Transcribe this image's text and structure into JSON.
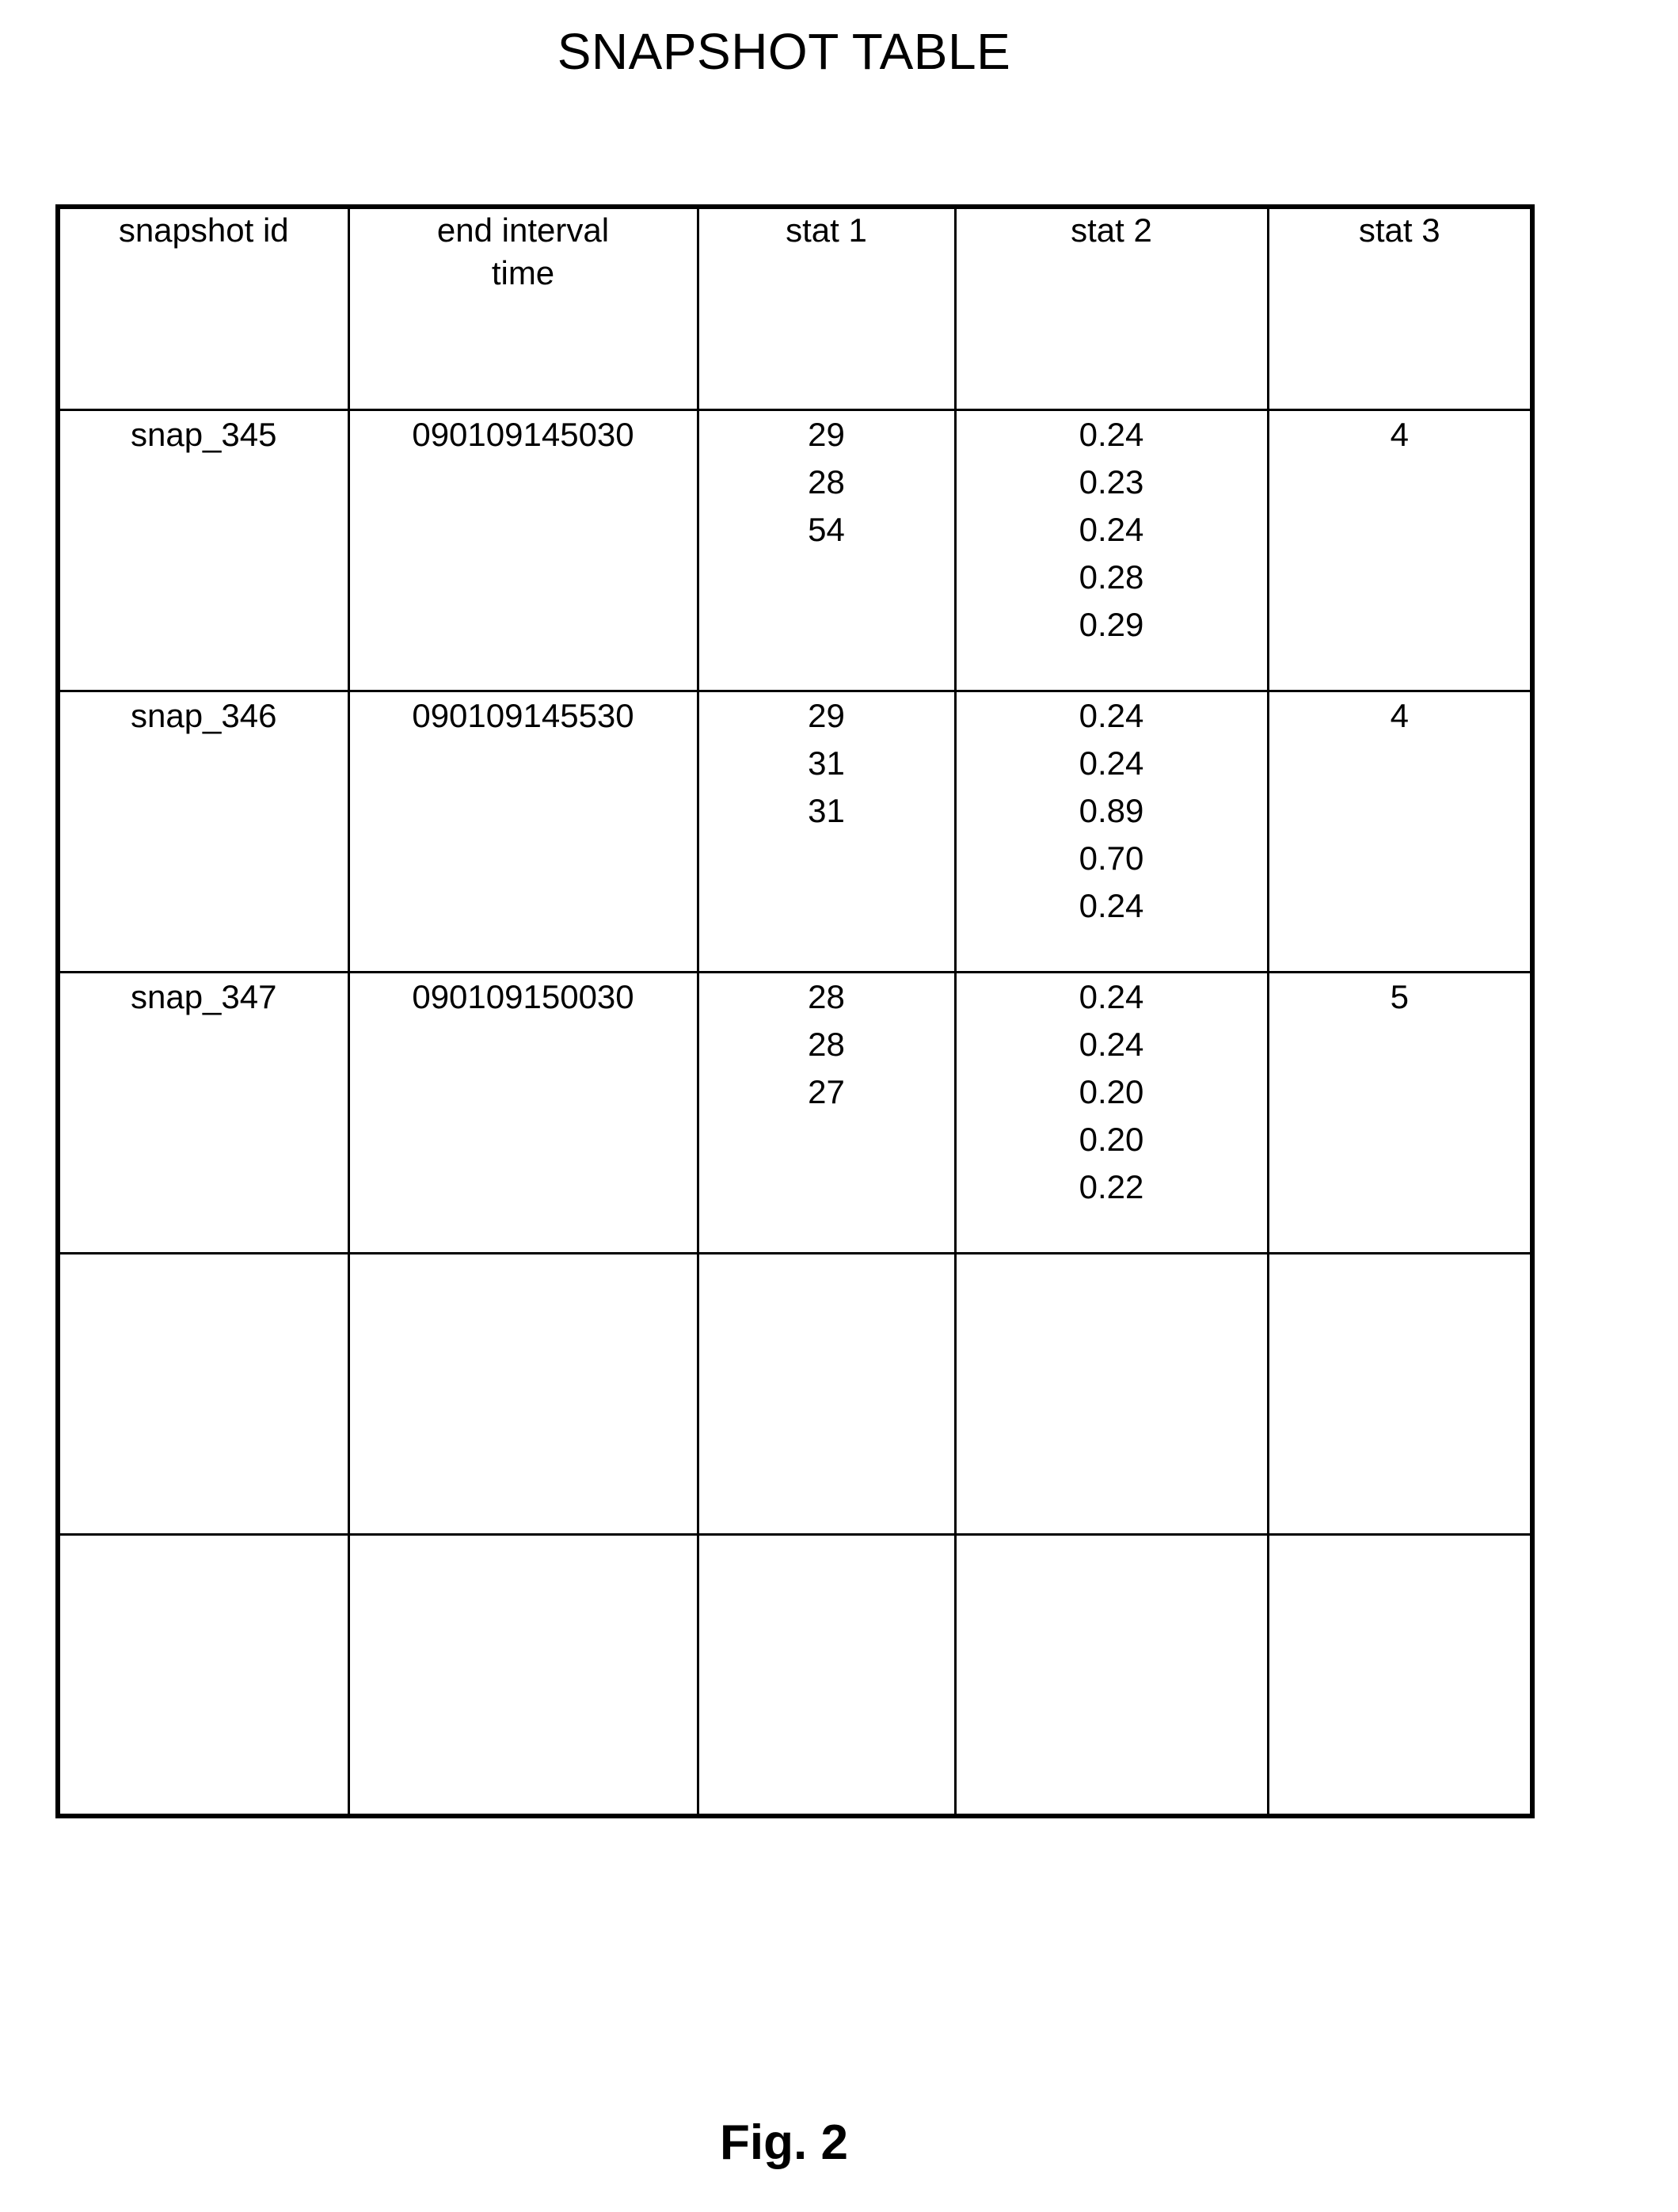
{
  "figure": {
    "title": "SNAPSHOT TABLE",
    "caption": "Fig. 2"
  },
  "table": {
    "columns": [
      {
        "key": "snapshot_id",
        "label": "snapshot id"
      },
      {
        "key": "end_interval_time",
        "label": "end interval\ntime"
      },
      {
        "key": "stat_1",
        "label": "stat 1"
      },
      {
        "key": "stat_2",
        "label": "stat 2"
      },
      {
        "key": "stat_3",
        "label": "stat 3"
      }
    ],
    "rows": [
      {
        "snapshot_id": "snap_345",
        "end_interval_time": "090109145030",
        "stat_1": "29\n28\n54",
        "stat_2": "0.24\n0.23\n0.24\n0.28\n0.29",
        "stat_3": "4"
      },
      {
        "snapshot_id": "snap_346",
        "end_interval_time": "090109145530",
        "stat_1": "29\n31\n31",
        "stat_2": "0.24\n0.24\n0.89\n0.70\n0.24",
        "stat_3": "4"
      },
      {
        "snapshot_id": "snap_347",
        "end_interval_time": "090109150030",
        "stat_1": "28\n28\n27",
        "stat_2": "0.24\n0.24\n0.20\n0.20\n0.22",
        "stat_3": "5"
      },
      {
        "snapshot_id": "",
        "end_interval_time": "",
        "stat_1": "",
        "stat_2": "",
        "stat_3": ""
      },
      {
        "snapshot_id": "",
        "end_interval_time": "",
        "stat_1": "",
        "stat_2": "",
        "stat_3": ""
      }
    ]
  },
  "colors": {
    "ink": "#000000",
    "paper": "#ffffff"
  }
}
